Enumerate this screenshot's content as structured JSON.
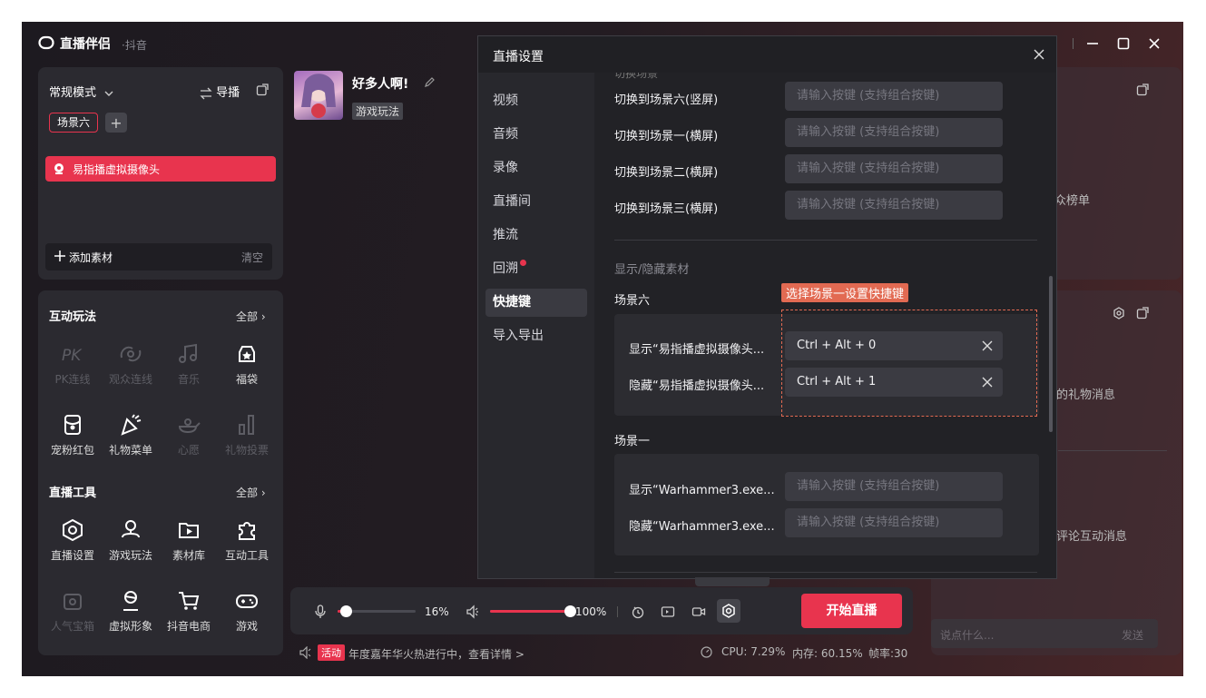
{
  "app": {
    "logo_text": "直播伴侣",
    "platform": "·抖音"
  },
  "window_controls": {
    "minimize": "─",
    "maximize": "☐",
    "close": "✕"
  },
  "scene_panel": {
    "mode_label": "常规模式",
    "guide_label": "导播",
    "scene_tab": "场景六",
    "add_scene": "+",
    "source_item": "易指播虚拟摄像头",
    "add_source": "添加素材",
    "clear": "清空"
  },
  "interactive": {
    "title": "互动玩法",
    "all": "全部",
    "items": [
      {
        "label": "PK连线",
        "enabled": false
      },
      {
        "label": "观众连线",
        "enabled": false
      },
      {
        "label": "音乐",
        "enabled": false
      },
      {
        "label": "福袋",
        "enabled": true
      },
      {
        "label": "宠粉红包",
        "enabled": true
      },
      {
        "label": "礼物菜单",
        "enabled": true
      },
      {
        "label": "心愿",
        "enabled": false
      },
      {
        "label": "礼物投票",
        "enabled": false
      }
    ]
  },
  "tools": {
    "title": "直播工具",
    "all": "全部",
    "items": [
      {
        "label": "直播设置",
        "enabled": true
      },
      {
        "label": "游戏玩法",
        "enabled": true
      },
      {
        "label": "素材库",
        "enabled": true
      },
      {
        "label": "互动工具",
        "enabled": true
      },
      {
        "label": "人气宝箱",
        "enabled": false
      },
      {
        "label": "虚拟形象",
        "enabled": true
      },
      {
        "label": "抖音电商",
        "enabled": true
      },
      {
        "label": "游戏",
        "enabled": true
      }
    ]
  },
  "stream": {
    "title": "好多人啊!",
    "category": "游戏玩法"
  },
  "bottom_bar": {
    "mic_level": 0.1,
    "mic_percent": "16%",
    "speaker_level": 1.0,
    "speaker_percent": "100%",
    "start_button": "开始直播",
    "activity_tag": "活动",
    "activity_text": "年度嘉年华火热进行中，查看详情 >",
    "cpu": "CPU: 7.29%",
    "memory": "内存: 60.15%",
    "fps": "帧率:30"
  },
  "right_panel": {
    "audience_rank": "众榜单",
    "gift_msgs": "的礼物消息",
    "comment_msgs": "评论互动消息",
    "chat_placeholder": "说点什么...",
    "send": "发送"
  },
  "dialog": {
    "title": "直播设置",
    "nav": [
      "视频",
      "音频",
      "录像",
      "直播间",
      "推流",
      "回溯",
      "快捷键",
      "导入导出"
    ],
    "active_nav": "快捷键",
    "cut_header": "切换场景",
    "placeholder": "请输入按键 (支持组合按键)",
    "switch_rows": [
      "切换到场景六(竖屏)",
      "切换到场景一(横屏)",
      "切换到场景二(横屏)",
      "切换到场景三(横屏)"
    ],
    "section_title": "显示/隐藏素材",
    "tooltip": "选择场景一设置快捷键",
    "scene6": {
      "name": "场景六",
      "show_label": "显示“易指播虚拟摄像头...",
      "show_key": "Ctrl + Alt + 0",
      "hide_label": "隐藏“易指播虚拟摄像头...",
      "hide_key": "Ctrl + Alt + 1"
    },
    "scene1": {
      "name": "场景一",
      "show_label": "显示“Warhammer3.exe...",
      "hide_label": "隐藏“Warhammer3.exe..."
    }
  },
  "colors": {
    "accent": "#e8344e",
    "panel": "#2b2a30",
    "dialog": "#28282d"
  }
}
